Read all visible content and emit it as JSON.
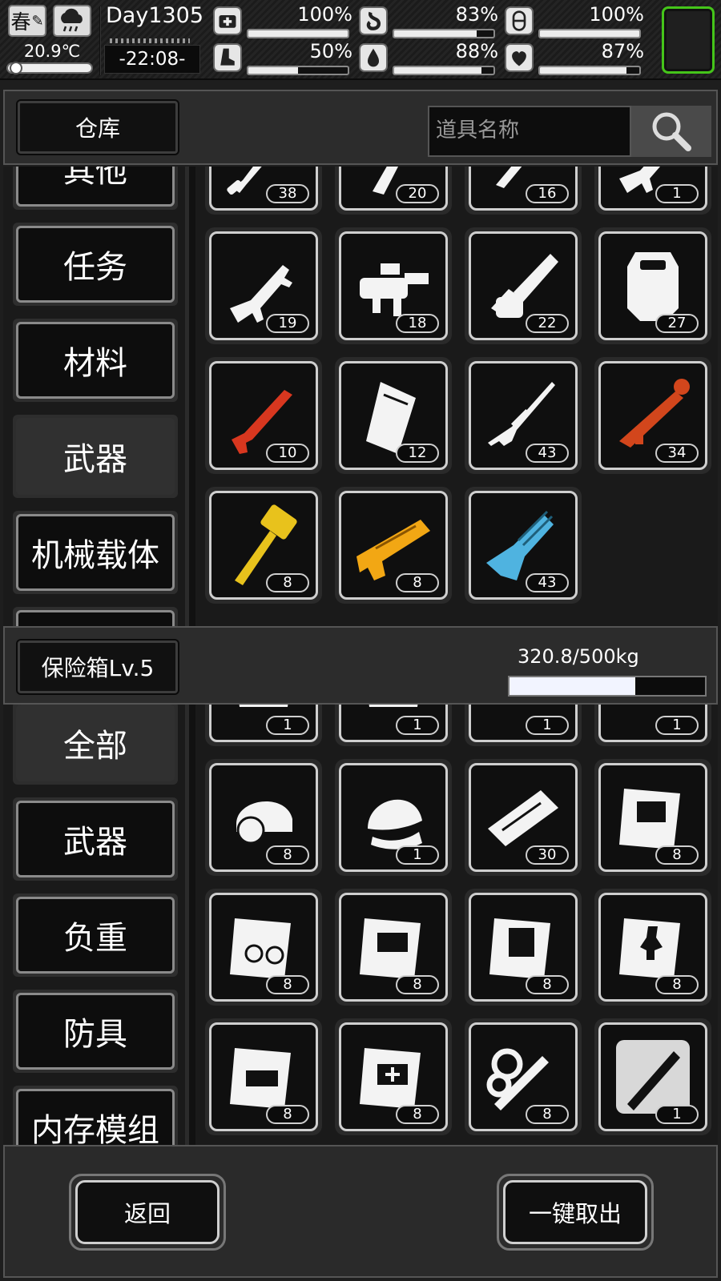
{
  "status": {
    "season": "春",
    "temperature": "20.9℃",
    "temperature_level": 0.12,
    "day": "Day1305",
    "clock": "-22:08-",
    "stats": [
      {
        "name": "health",
        "icon": "medkit-icon",
        "value": "100%",
        "fill": 1.0
      },
      {
        "name": "hunger",
        "icon": "stomach-icon",
        "value": "83%",
        "fill": 0.83
      },
      {
        "name": "stamina",
        "icon": "capsule-icon",
        "value": "100%",
        "fill": 1.0
      },
      {
        "name": "leg",
        "icon": "boot-icon",
        "value": "50%",
        "fill": 0.5
      },
      {
        "name": "thirst",
        "icon": "water-drop-icon",
        "value": "88%",
        "fill": 0.88
      },
      {
        "name": "mood",
        "icon": "heart-icon",
        "value": "87%",
        "fill": 0.87
      }
    ],
    "avatar_border": "#45c51a"
  },
  "warehouse": {
    "title": "仓库",
    "search_placeholder": "道具名称",
    "categories": [
      "其他",
      "任务",
      "材料",
      "武器",
      "机械载体",
      ""
    ],
    "active_category": "武器",
    "items": [
      {
        "icon": "machete-icon",
        "count": "38"
      },
      {
        "icon": "wrench-blade-icon",
        "count": "20"
      },
      {
        "icon": "rifle-icon",
        "count": "16"
      },
      {
        "icon": "assault-rifle-icon",
        "count": "1"
      },
      {
        "icon": "assault-rifle-icon",
        "count": "19"
      },
      {
        "icon": "grenade-launcher-icon",
        "count": "18"
      },
      {
        "icon": "chainsaw-icon",
        "count": "22"
      },
      {
        "icon": "riot-shield-icon",
        "count": "27"
      },
      {
        "icon": "shotgun-icon",
        "count": "10",
        "color": "#d8371f"
      },
      {
        "icon": "heavy-shield-icon",
        "count": "12"
      },
      {
        "icon": "sniper-rifle-icon",
        "count": "43"
      },
      {
        "icon": "rocket-launcher-icon",
        "count": "34",
        "color": "#d2461c"
      },
      {
        "icon": "hammer-icon",
        "count": "8",
        "color": "#e8c21c"
      },
      {
        "icon": "blaster-gun-icon",
        "count": "8",
        "color": "#f2a714"
      },
      {
        "icon": "minigun-icon",
        "count": "43",
        "color": "#4fb3e0"
      }
    ]
  },
  "safebox": {
    "title": "保险箱Lv.5",
    "capacity": "320.8/500kg",
    "capacity_fill": 0.6416,
    "categories": [
      "全部",
      "武器",
      "负重",
      "防具",
      "内存模组"
    ],
    "active_category": "全部",
    "items": [
      {
        "icon": "wing-helmet-icon",
        "count": "1"
      },
      {
        "icon": "wing-helmet-icon",
        "count": "1"
      },
      {
        "icon": "cap-icon",
        "count": "1"
      },
      {
        "icon": "cap-icon",
        "count": "1"
      },
      {
        "icon": "hard-hat-icon",
        "count": "8"
      },
      {
        "icon": "beanie-icon",
        "count": "1"
      },
      {
        "icon": "memory-module-icon",
        "count": "30"
      },
      {
        "icon": "blueprint-machine-icon",
        "count": "8"
      },
      {
        "icon": "blueprint-bike-icon",
        "count": "8"
      },
      {
        "icon": "blueprint-toolbox-icon",
        "count": "8"
      },
      {
        "icon": "blueprint-cooler-icon",
        "count": "8"
      },
      {
        "icon": "blueprint-statue-icon",
        "count": "8"
      },
      {
        "icon": "blueprint-crate-icon",
        "count": "8"
      },
      {
        "icon": "blueprint-medkit-icon",
        "count": "8"
      },
      {
        "icon": "smoke-pipe-icon",
        "count": "8"
      },
      {
        "icon": "tool-blade-icon",
        "count": "1"
      }
    ]
  },
  "footer": {
    "back_label": "返回",
    "take_all_label": "一键取出"
  }
}
